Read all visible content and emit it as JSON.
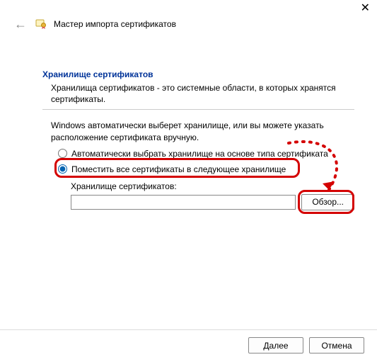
{
  "header": {
    "title": "Мастер импорта сертификатов"
  },
  "section": {
    "title": "Хранилище сертификатов",
    "desc": "Хранилища сертификатов - это системные области, в которых хранятся сертификаты."
  },
  "instr": "Windows автоматически выберет хранилище, или вы можете указать расположение сертификата вручную.",
  "radio": {
    "auto": "Автоматически выбрать хранилище на основе типа сертификата",
    "manual": "Поместить все сертификаты в следующее хранилище"
  },
  "store": {
    "label": "Хранилище сертификатов:",
    "value": "",
    "browse": "Обзор..."
  },
  "footer": {
    "next": "Далее",
    "cancel": "Отмена"
  }
}
